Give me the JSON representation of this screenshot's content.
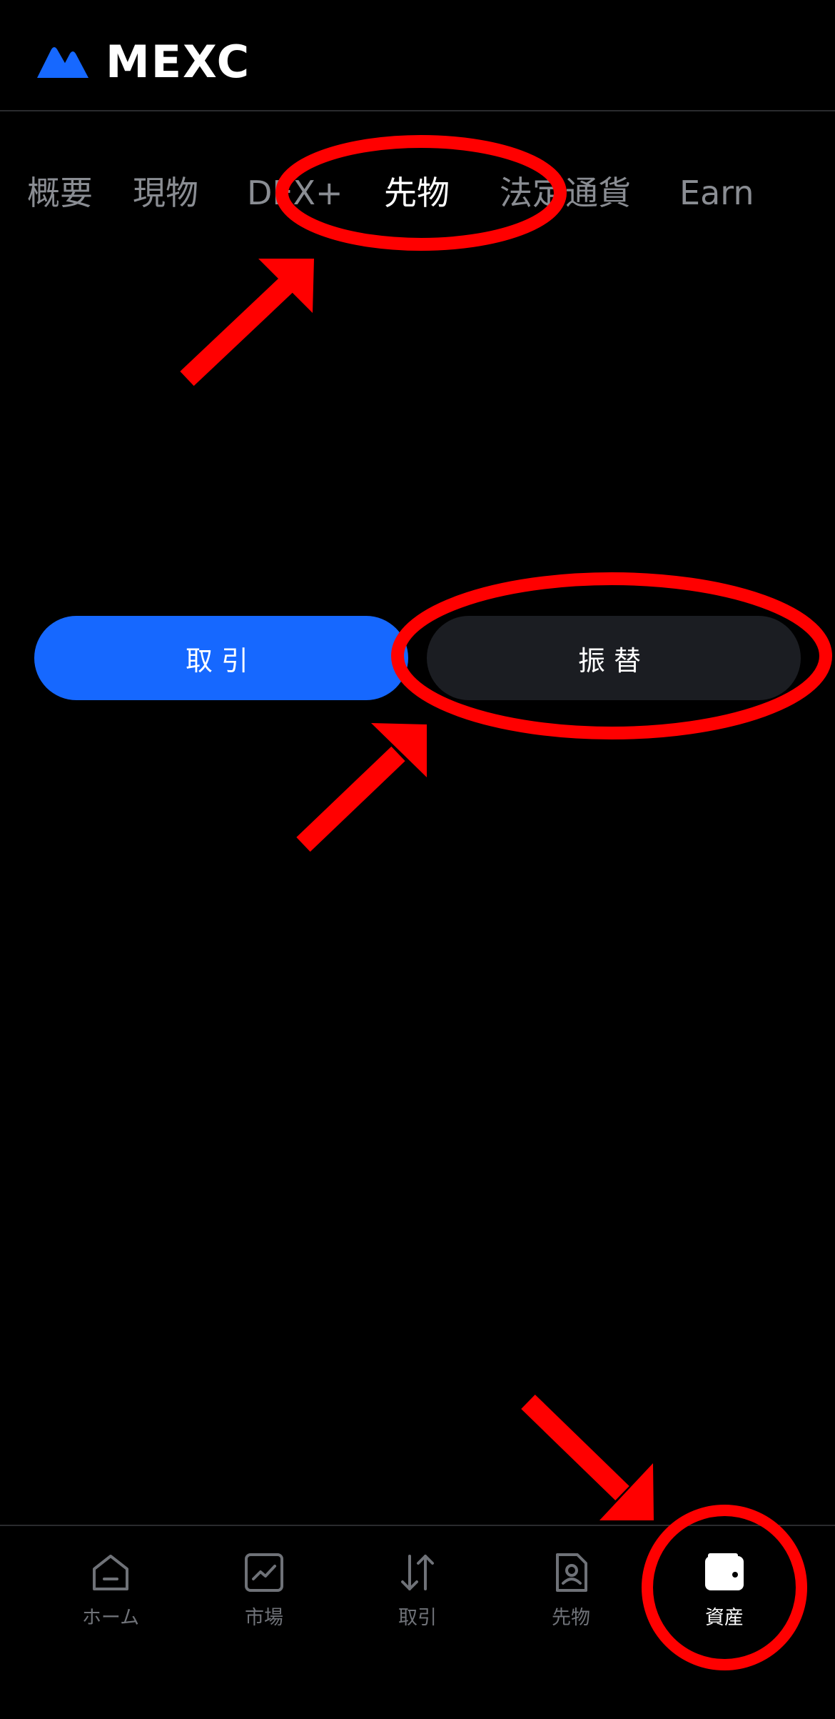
{
  "brand": {
    "name": "MEXC",
    "accent": "#1668ff"
  },
  "tabs": [
    {
      "label": "概要",
      "active": false
    },
    {
      "label": "現物",
      "active": false
    },
    {
      "label": "DEX+",
      "active": false
    },
    {
      "label": "先物",
      "active": true
    },
    {
      "label": "法定通貨",
      "active": false
    },
    {
      "label": "Earn",
      "active": false
    }
  ],
  "actions": {
    "trade_label": "取引",
    "transfer_label": "振替"
  },
  "bottom_nav": [
    {
      "label": "ホーム",
      "icon": "home-icon",
      "active": false
    },
    {
      "label": "市場",
      "icon": "market-chart-icon",
      "active": false
    },
    {
      "label": "取引",
      "icon": "trade-arrows-icon",
      "active": false
    },
    {
      "label": "先物",
      "icon": "futures-document-icon",
      "active": false
    },
    {
      "label": "資産",
      "icon": "wallet-icon",
      "active": true
    }
  ],
  "annotation_color": "#ff0000"
}
